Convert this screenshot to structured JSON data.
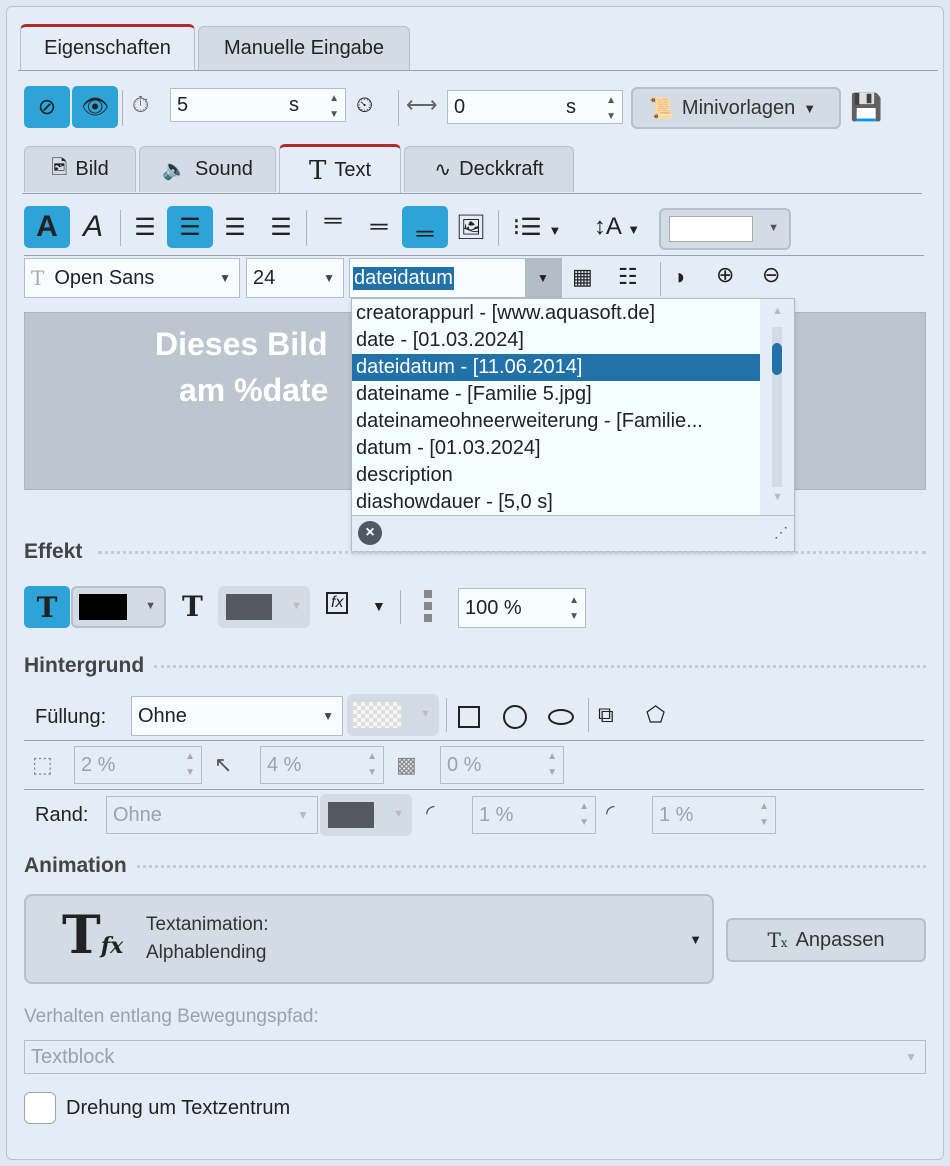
{
  "main_tabs": [
    {
      "label": "Eigenschaften",
      "active": true
    },
    {
      "label": "Manuelle Eingabe",
      "active": false
    }
  ],
  "toolbar": {
    "duration_value": "5",
    "duration_unit": "s",
    "offset_value": "0",
    "offset_unit": "s",
    "minivorlagen_label": "Minivorlagen"
  },
  "sub_tabs": [
    {
      "label": "Bild"
    },
    {
      "label": "Sound"
    },
    {
      "label": "Text",
      "active": true
    },
    {
      "label": "Deckkraft"
    }
  ],
  "text_toolbar": {
    "font": "Open Sans",
    "size": "24",
    "placeholder_value": "dateidatum"
  },
  "preview": {
    "line1": "Dieses Bild",
    "line2": "am %date",
    "background": "#bdc5cf"
  },
  "dropdown": {
    "items": [
      "creatorappurl  -  [www.aquasoft.de]",
      "date  -  [01.03.2024]",
      "dateidatum  -  [11.06.2014]",
      "dateiname  -  [Familie 5.jpg]",
      "dateinameohneerweiterung  -  [Familie...",
      "datum  -  [01.03.2024]",
      "description",
      "diashowdauer  -  [5,0 s]"
    ],
    "selected_index": 2
  },
  "effekt": {
    "title": "Effekt",
    "opacity": "100 %",
    "color": "#000000"
  },
  "hintergrund": {
    "title": "Hintergrund",
    "fill_label": "Füllung:",
    "fill_value": "Ohne",
    "corner": "2 %",
    "radius": "4 %",
    "shadow": "0 %",
    "border_label": "Rand:",
    "border_value": "Ohne",
    "border_w1": "1 %",
    "border_w2": "1 %"
  },
  "animation": {
    "title": "Animation",
    "name_label": "Textanimation:",
    "name_value": "Alphablending",
    "adjust_label": "Anpassen",
    "path_label": "Verhalten entlang Bewegungspfad:",
    "path_value": "Textblock",
    "rotate_label": "Drehung um Textzentrum",
    "rotate_checked": false
  },
  "colors": {
    "accent": "#2ea3d8",
    "selection": "#2272a9",
    "active_tab": "#b52a2a"
  }
}
